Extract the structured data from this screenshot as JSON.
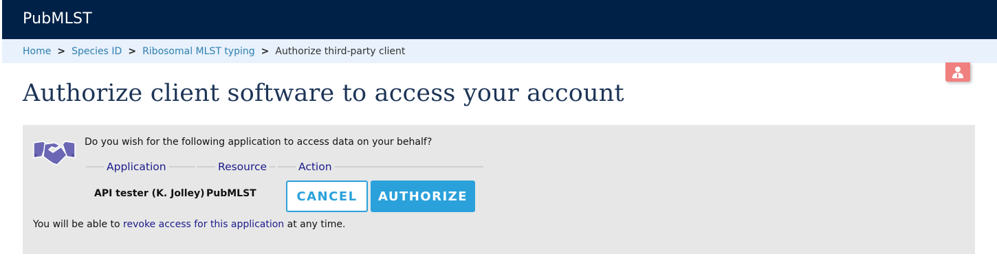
{
  "header": {
    "site_title": "PubMLST"
  },
  "breadcrumb": {
    "items": [
      "Home",
      "Species ID",
      "Ribosomal MLST typing"
    ],
    "separator": ">",
    "current": "Authorize third-party client"
  },
  "toolbar": {
    "user_icon": "user-icon",
    "user_icon_color": "#f08080"
  },
  "main": {
    "heading": "Authorize client software to access your account",
    "panel": {
      "icon": "handshake-icon",
      "question": "Do you wish for the following application to access data on your behalf?",
      "columns": [
        {
          "legend": "Application",
          "value": "API tester (K. Jolley)"
        },
        {
          "legend": "Resource",
          "value": "PubMLST"
        },
        {
          "legend": "Action",
          "value": ""
        }
      ],
      "cancel_label": "CANCEL",
      "authorize_label": "AUTHORIZE",
      "revoke_prefix": "You will be able to ",
      "revoke_link": "revoke access for this application",
      "revoke_suffix": " at any time."
    }
  },
  "colors": {
    "header_bg": "#002147",
    "breadcrumb_bg": "#e8f1fc",
    "link": "#2e7fae",
    "accent": "#2aa1db",
    "panel_bg": "#e7e7e7",
    "legend": "#1a1a8c"
  }
}
